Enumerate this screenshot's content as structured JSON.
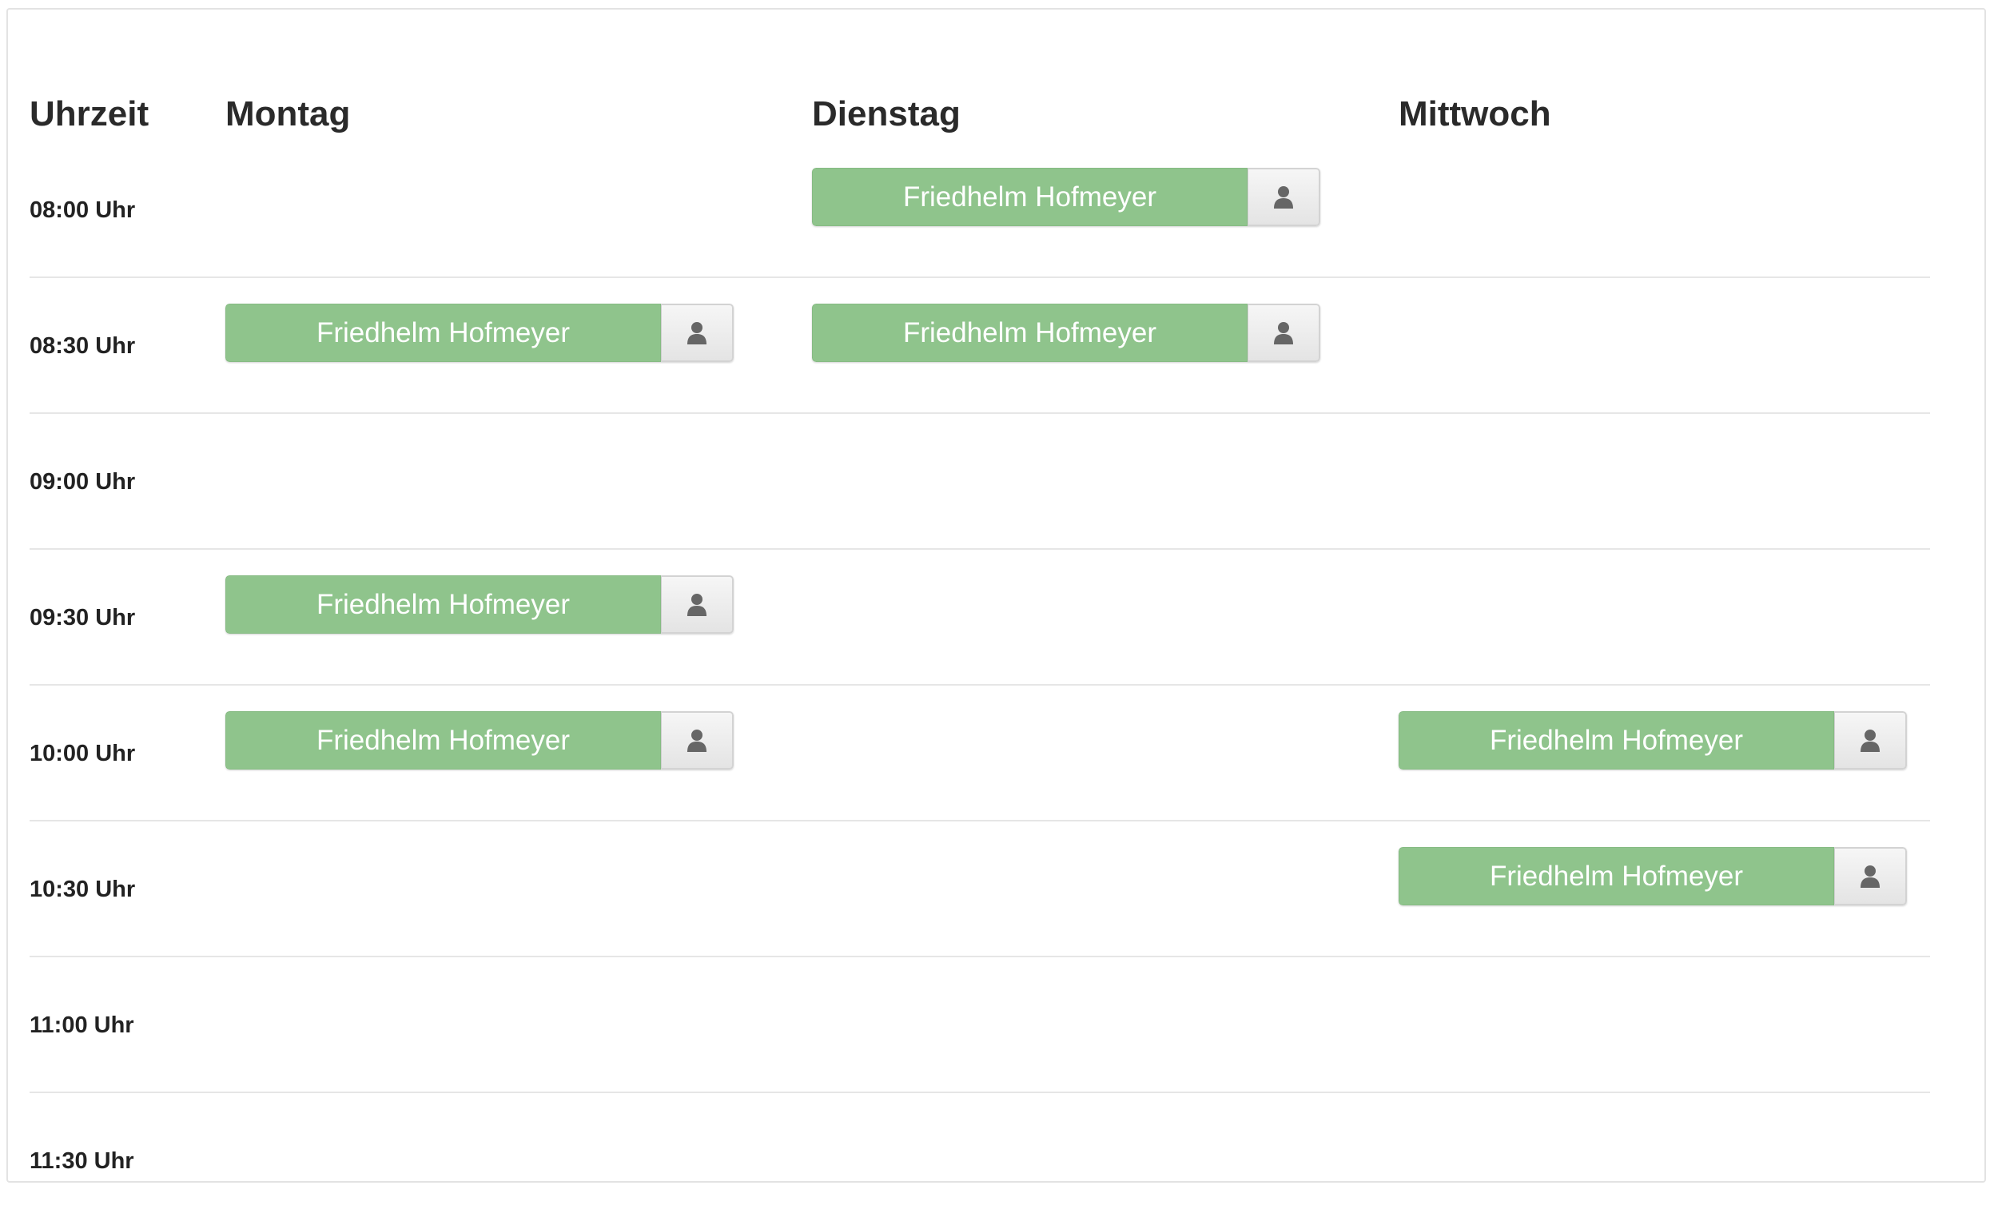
{
  "header": {
    "time_col": "Uhrzeit",
    "days": [
      "Montag",
      "Dienstag",
      "Mittwoch"
    ]
  },
  "rows": [
    {
      "time": "08:00 Uhr",
      "slots": [
        null,
        "Friedhelm Hofmeyer",
        null
      ]
    },
    {
      "time": "08:30 Uhr",
      "slots": [
        "Friedhelm Hofmeyer",
        "Friedhelm Hofmeyer",
        null
      ]
    },
    {
      "time": "09:00 Uhr",
      "slots": [
        null,
        null,
        null
      ]
    },
    {
      "time": "09:30 Uhr",
      "slots": [
        "Friedhelm Hofmeyer",
        null,
        null
      ]
    },
    {
      "time": "10:00 Uhr",
      "slots": [
        "Friedhelm Hofmeyer",
        null,
        "Friedhelm Hofmeyer"
      ]
    },
    {
      "time": "10:30 Uhr",
      "slots": [
        null,
        null,
        "Friedhelm Hofmeyer"
      ]
    },
    {
      "time": "11:00 Uhr",
      "slots": [
        null,
        null,
        null
      ]
    },
    {
      "time": "11:30 Uhr",
      "slots": [
        null,
        null,
        null
      ]
    }
  ],
  "icons": {
    "slot_action": "user-icon"
  },
  "colors": {
    "booked": "#8fc48c",
    "text_on_booked": "#ffffff",
    "action_bg": "#ececec",
    "divider": "#e6e6e6",
    "icon": "#666666"
  }
}
